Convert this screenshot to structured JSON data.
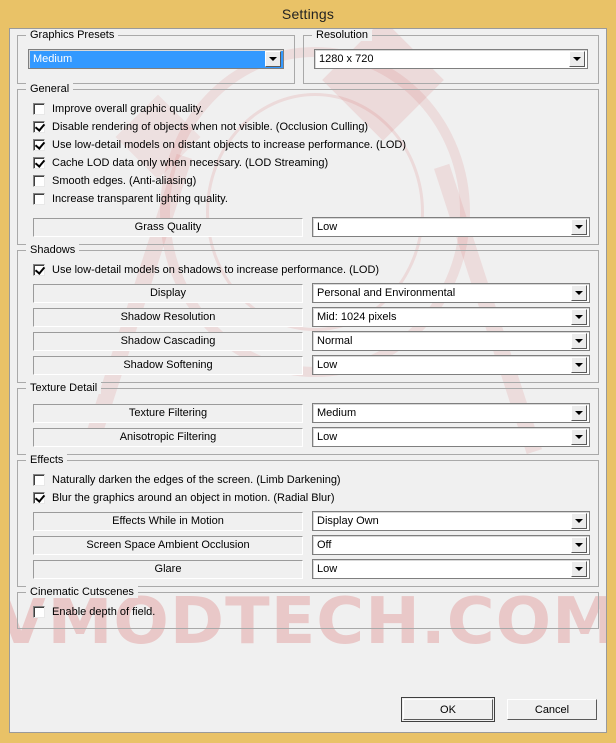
{
  "window": {
    "title": "Settings",
    "title_bar_color": "#e9c267",
    "client_bg": "#f0f0f0",
    "accent_selected": "#3399ff"
  },
  "watermark": {
    "text": "VMODTECH.COM",
    "color": "#d65656"
  },
  "presets": {
    "legend": "Graphics Presets",
    "combo": {
      "value": "Medium",
      "selected": true,
      "icon": "chevron-down-icon"
    }
  },
  "resolution": {
    "legend": "Resolution",
    "combo": {
      "value": "1280 x 720",
      "selected": false,
      "icon": "chevron-down-icon"
    }
  },
  "general": {
    "legend": "General",
    "checkboxes": [
      {
        "label": "Improve overall graphic quality.",
        "checked": false
      },
      {
        "label": "Disable rendering of objects when not visible. (Occlusion Culling)",
        "checked": true
      },
      {
        "label": "Use low-detail models on distant objects to increase performance. (LOD)",
        "checked": true
      },
      {
        "label": "Cache LOD data only when necessary. (LOD Streaming)",
        "checked": true
      },
      {
        "label": "Smooth edges. (Anti-aliasing)",
        "checked": false
      },
      {
        "label": "Increase transparent lighting quality.",
        "checked": false
      }
    ],
    "settings": [
      {
        "label": "Grass Quality",
        "value": "Low"
      }
    ]
  },
  "shadows": {
    "legend": "Shadows",
    "checkboxes": [
      {
        "label": "Use low-detail models on shadows to increase performance. (LOD)",
        "checked": true
      }
    ],
    "settings": [
      {
        "label": "Display",
        "value": "Personal and Environmental"
      },
      {
        "label": "Shadow Resolution",
        "value": "Mid: 1024 pixels"
      },
      {
        "label": "Shadow Cascading",
        "value": "Normal"
      },
      {
        "label": "Shadow Softening",
        "value": "Low"
      }
    ]
  },
  "texture_detail": {
    "legend": "Texture Detail",
    "settings": [
      {
        "label": "Texture Filtering",
        "value": "Medium"
      },
      {
        "label": "Anisotropic Filtering",
        "value": "Low"
      }
    ]
  },
  "effects": {
    "legend": "Effects",
    "checkboxes": [
      {
        "label": "Naturally darken the edges of the screen. (Limb Darkening)",
        "checked": false
      },
      {
        "label": "Blur the graphics around an object in motion. (Radial Blur)",
        "checked": true
      }
    ],
    "settings": [
      {
        "label": "Effects While in Motion",
        "value": "Display Own"
      },
      {
        "label": "Screen Space Ambient Occlusion",
        "value": "Off"
      },
      {
        "label": "Glare",
        "value": "Low"
      }
    ]
  },
  "cinematic": {
    "legend": "Cinematic Cutscenes",
    "checkboxes": [
      {
        "label": "Enable depth of field.",
        "checked": false
      }
    ]
  },
  "buttons": {
    "ok": "OK",
    "cancel": "Cancel"
  }
}
